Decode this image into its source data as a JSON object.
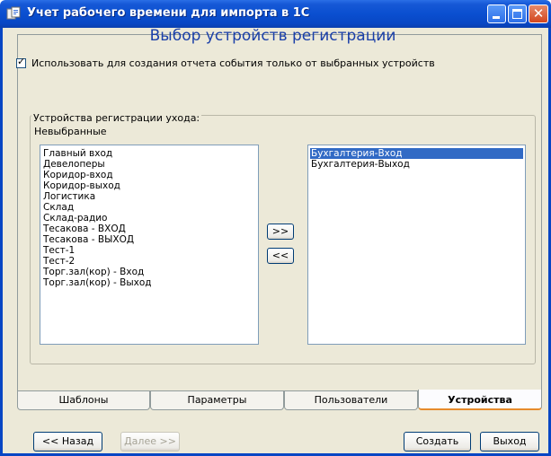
{
  "window": {
    "title": "Учет рабочего времени для импорта в 1С",
    "minimize_icon": "minimize-icon",
    "maximize_icon": "maximize-icon",
    "close_icon": "close-icon",
    "close_glyph": "✕",
    "colors": {
      "titlebar": "#0a4fd0",
      "title_text": "#ffffff",
      "heading": "#1a3fa8",
      "selection": "#316ac5",
      "active_tab_accent": "#e68b2c"
    }
  },
  "page": {
    "title": "Выбор устройств регистрации",
    "checkbox": {
      "label": "Использовать для создания отчета события только от выбранных устройств",
      "checked": true,
      "tick": "✓"
    },
    "group_label": "Устройства регистрации ухода:",
    "unselected_label": "Невыбранные"
  },
  "lists": {
    "unselected": [
      "Главный вход",
      "Девелоперы",
      "Коридор-вход",
      "Коридор-выход",
      "Логистика",
      "Склад",
      "Склад-радио",
      "Тесакова - ВХОД",
      "Тесакова - ВЫХОД",
      "Тест-1",
      "Тест-2",
      "Торг.зал(кор) - Вход",
      "Торг.зал(кор) - Выход"
    ],
    "selected": [
      {
        "label": "Бухгалтерия-Вход",
        "highlighted": true
      },
      {
        "label": "Бухгалтерия-Выход",
        "highlighted": false
      }
    ]
  },
  "transfer": {
    "add_label": ">>",
    "remove_label": "<<"
  },
  "tabs": [
    {
      "label": "Шаблоны",
      "active": false
    },
    {
      "label": "Параметры",
      "active": false
    },
    {
      "label": "Пользователи",
      "active": false
    },
    {
      "label": "Устройства",
      "active": true
    }
  ],
  "footer": {
    "back_label": "<< Назад",
    "next_label": "Далее >>",
    "next_disabled": true,
    "create_label": "Создать",
    "exit_label": "Выход"
  }
}
